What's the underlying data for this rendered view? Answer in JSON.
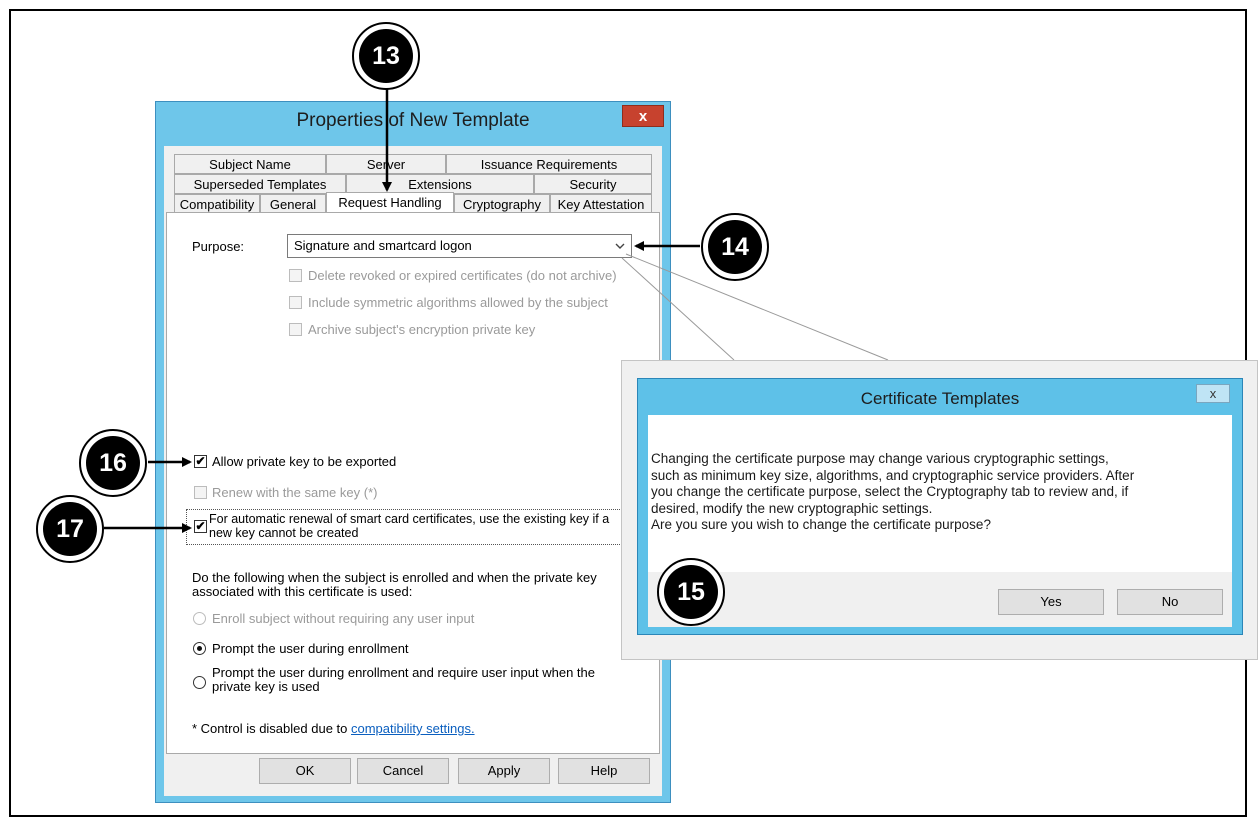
{
  "main_dialog": {
    "title": "Properties of New Template",
    "close_label": "x",
    "tabs_row1": [
      "Subject Name",
      "Server",
      "Issuance Requirements"
    ],
    "tabs_row2": [
      "Superseded Templates",
      "Extensions",
      "Security"
    ],
    "tabs_row3": [
      "Compatibility",
      "General",
      "Request Handling",
      "Cryptography",
      "Key Attestation"
    ],
    "selected_tab": "Request Handling",
    "purpose_label": "Purpose:",
    "purpose_value": "Signature and smartcard logon",
    "checkbox_delete_revoked": "Delete revoked or expired certificates (do not archive)",
    "checkbox_symmetric": "Include symmetric algorithms allowed by the subject",
    "checkbox_archive": "Archive subject's encryption private key",
    "checkbox_allow_export": "Allow private key to be exported",
    "checkbox_renew_same": "Renew with the same key (*)",
    "checkbox_auto_renewal_line1": "For automatic renewal of smart card certificates, use the existing key if a",
    "checkbox_auto_renewal_line2": "new key cannot be created",
    "enroll_text_line1": "Do the following when the subject is enrolled and when the private key",
    "enroll_text_line2": "associated with this certificate is used:",
    "radio_enroll_no_input": "Enroll subject without requiring any user input",
    "radio_prompt": "Prompt the user during enrollment",
    "radio_prompt_require_line1": "Prompt the user during enrollment and require user input when the",
    "radio_prompt_require_line2": "private key is used",
    "footnote_prefix": "* Control is disabled due to",
    "footnote_link": "compatibility settings.",
    "buttons": {
      "ok": "OK",
      "cancel": "Cancel",
      "apply": "Apply",
      "help": "Help"
    }
  },
  "popup_dialog": {
    "title": "Certificate Templates",
    "close_label": "x",
    "message_lines": [
      "Changing the certificate purpose may change various cryptographic settings,",
      "such as minimum key size, algorithms, and cryptographic service providers.  After",
      "you change the certificate purpose, select the Cryptography tab to review and, if",
      "desired, modify the new cryptographic settings.",
      "Are you sure you wish to change the certificate purpose?"
    ],
    "yes_label": "Yes",
    "no_label": "No"
  },
  "callouts": {
    "c13": "13",
    "c14": "14",
    "c15": "15",
    "c16": "16",
    "c17": "17"
  },
  "checkbox_mark": "✔",
  "dropdown_icon": "chevron-down-icon",
  "colors": {
    "title_bar": "#6ec6ea",
    "popup_title_bar": "#5ec1e8",
    "close_red": "#c7422e",
    "link": "#0b5fbf"
  }
}
